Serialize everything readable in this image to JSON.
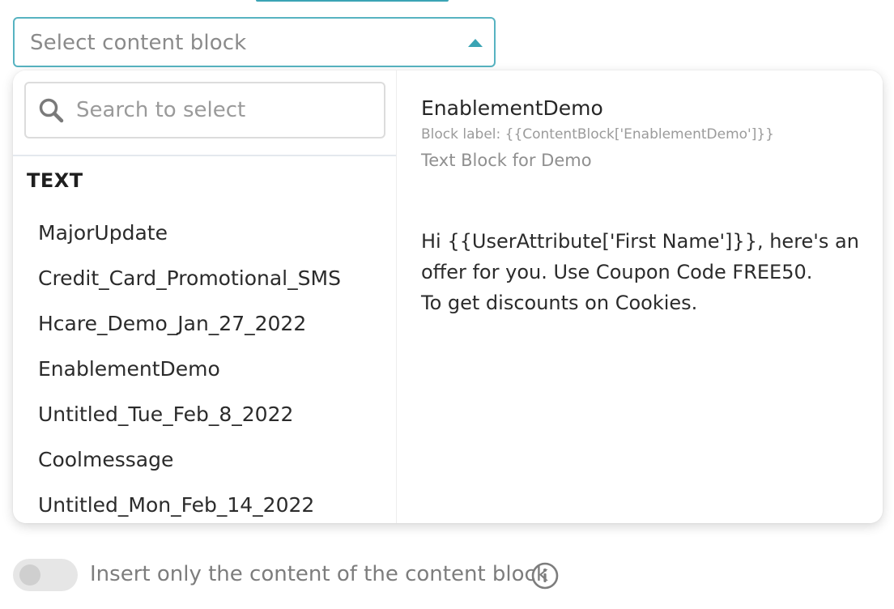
{
  "select": {
    "placeholder": "Select content block"
  },
  "search": {
    "placeholder": "Search to select"
  },
  "group": {
    "header": "TEXT"
  },
  "options": [
    "MajorUpdate",
    "Credit_Card_Promotional_SMS",
    "Hcare_Demo_Jan_27_2022",
    "EnablementDemo",
    "Untitled_Tue_Feb_8_2022",
    "Coolmessage",
    "Untitled_Mon_Feb_14_2022"
  ],
  "preview": {
    "title": "EnablementDemo",
    "label": "Block label: {{ContentBlock['EnablementDemo']}}",
    "description": "Text Block for Demo",
    "body_lines": [
      "Hi {{UserAttribute['First Name']}}, here's an",
      "offer for you. Use Coupon Code FREE50.",
      "To get discounts on Cookies."
    ]
  },
  "toggle": {
    "label": "Insert only the content of the content block",
    "enabled": false
  },
  "colors": {
    "accent": "#3aa4b4",
    "select_border": "#57b3c1"
  },
  "icons": {
    "dropdown": "caret-up-icon",
    "search": "search-icon",
    "info": "info-icon"
  }
}
